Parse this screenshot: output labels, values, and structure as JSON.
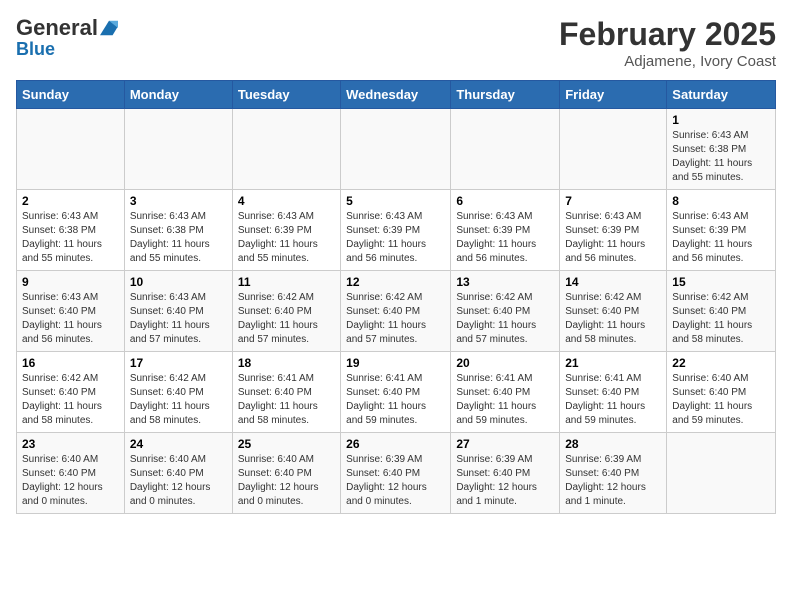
{
  "header": {
    "logo_line1": "General",
    "logo_line2": "Blue",
    "title": "February 2025",
    "subtitle": "Adjamene, Ivory Coast"
  },
  "days_of_week": [
    "Sunday",
    "Monday",
    "Tuesday",
    "Wednesday",
    "Thursday",
    "Friday",
    "Saturday"
  ],
  "weeks": [
    [
      {
        "day": "",
        "info": ""
      },
      {
        "day": "",
        "info": ""
      },
      {
        "day": "",
        "info": ""
      },
      {
        "day": "",
        "info": ""
      },
      {
        "day": "",
        "info": ""
      },
      {
        "day": "",
        "info": ""
      },
      {
        "day": "1",
        "info": "Sunrise: 6:43 AM\nSunset: 6:38 PM\nDaylight: 11 hours and 55 minutes."
      }
    ],
    [
      {
        "day": "2",
        "info": "Sunrise: 6:43 AM\nSunset: 6:38 PM\nDaylight: 11 hours and 55 minutes."
      },
      {
        "day": "3",
        "info": "Sunrise: 6:43 AM\nSunset: 6:38 PM\nDaylight: 11 hours and 55 minutes."
      },
      {
        "day": "4",
        "info": "Sunrise: 6:43 AM\nSunset: 6:39 PM\nDaylight: 11 hours and 55 minutes."
      },
      {
        "day": "5",
        "info": "Sunrise: 6:43 AM\nSunset: 6:39 PM\nDaylight: 11 hours and 56 minutes."
      },
      {
        "day": "6",
        "info": "Sunrise: 6:43 AM\nSunset: 6:39 PM\nDaylight: 11 hours and 56 minutes."
      },
      {
        "day": "7",
        "info": "Sunrise: 6:43 AM\nSunset: 6:39 PM\nDaylight: 11 hours and 56 minutes."
      },
      {
        "day": "8",
        "info": "Sunrise: 6:43 AM\nSunset: 6:39 PM\nDaylight: 11 hours and 56 minutes."
      }
    ],
    [
      {
        "day": "9",
        "info": "Sunrise: 6:43 AM\nSunset: 6:40 PM\nDaylight: 11 hours and 56 minutes."
      },
      {
        "day": "10",
        "info": "Sunrise: 6:43 AM\nSunset: 6:40 PM\nDaylight: 11 hours and 57 minutes."
      },
      {
        "day": "11",
        "info": "Sunrise: 6:42 AM\nSunset: 6:40 PM\nDaylight: 11 hours and 57 minutes."
      },
      {
        "day": "12",
        "info": "Sunrise: 6:42 AM\nSunset: 6:40 PM\nDaylight: 11 hours and 57 minutes."
      },
      {
        "day": "13",
        "info": "Sunrise: 6:42 AM\nSunset: 6:40 PM\nDaylight: 11 hours and 57 minutes."
      },
      {
        "day": "14",
        "info": "Sunrise: 6:42 AM\nSunset: 6:40 PM\nDaylight: 11 hours and 58 minutes."
      },
      {
        "day": "15",
        "info": "Sunrise: 6:42 AM\nSunset: 6:40 PM\nDaylight: 11 hours and 58 minutes."
      }
    ],
    [
      {
        "day": "16",
        "info": "Sunrise: 6:42 AM\nSunset: 6:40 PM\nDaylight: 11 hours and 58 minutes."
      },
      {
        "day": "17",
        "info": "Sunrise: 6:42 AM\nSunset: 6:40 PM\nDaylight: 11 hours and 58 minutes."
      },
      {
        "day": "18",
        "info": "Sunrise: 6:41 AM\nSunset: 6:40 PM\nDaylight: 11 hours and 58 minutes."
      },
      {
        "day": "19",
        "info": "Sunrise: 6:41 AM\nSunset: 6:40 PM\nDaylight: 11 hours and 59 minutes."
      },
      {
        "day": "20",
        "info": "Sunrise: 6:41 AM\nSunset: 6:40 PM\nDaylight: 11 hours and 59 minutes."
      },
      {
        "day": "21",
        "info": "Sunrise: 6:41 AM\nSunset: 6:40 PM\nDaylight: 11 hours and 59 minutes."
      },
      {
        "day": "22",
        "info": "Sunrise: 6:40 AM\nSunset: 6:40 PM\nDaylight: 11 hours and 59 minutes."
      }
    ],
    [
      {
        "day": "23",
        "info": "Sunrise: 6:40 AM\nSunset: 6:40 PM\nDaylight: 12 hours and 0 minutes."
      },
      {
        "day": "24",
        "info": "Sunrise: 6:40 AM\nSunset: 6:40 PM\nDaylight: 12 hours and 0 minutes."
      },
      {
        "day": "25",
        "info": "Sunrise: 6:40 AM\nSunset: 6:40 PM\nDaylight: 12 hours and 0 minutes."
      },
      {
        "day": "26",
        "info": "Sunrise: 6:39 AM\nSunset: 6:40 PM\nDaylight: 12 hours and 0 minutes."
      },
      {
        "day": "27",
        "info": "Sunrise: 6:39 AM\nSunset: 6:40 PM\nDaylight: 12 hours and 1 minute."
      },
      {
        "day": "28",
        "info": "Sunrise: 6:39 AM\nSunset: 6:40 PM\nDaylight: 12 hours and 1 minute."
      },
      {
        "day": "",
        "info": ""
      }
    ]
  ]
}
